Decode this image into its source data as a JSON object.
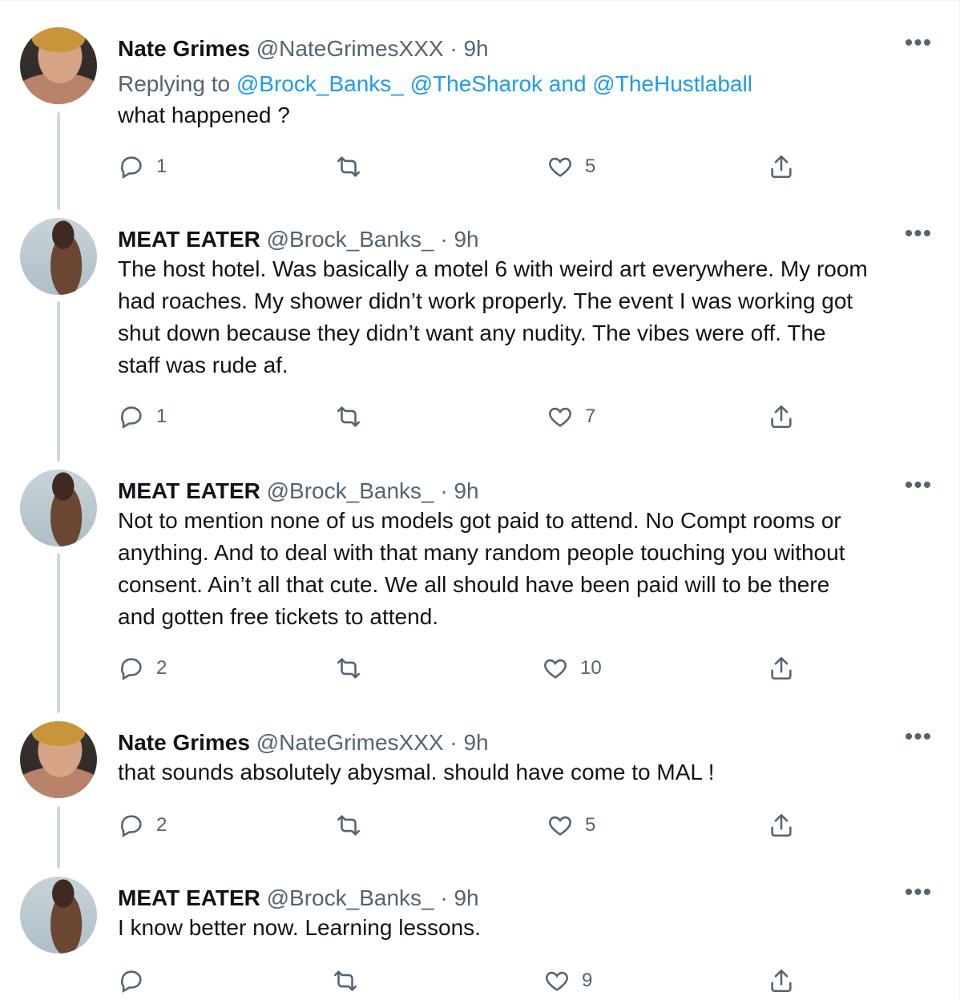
{
  "tweets": [
    {
      "name": "Nate Grimes",
      "handle": "@NateGrimesXXX",
      "separator": "·",
      "time": "9h",
      "more": "•••",
      "reply_prefix": "Replying to",
      "reply_handles": [
        "@Brock_Banks_",
        "@TheSharok",
        "@TheHustlaball"
      ],
      "reply_and": "and",
      "text": "what happened ?",
      "replies": "1",
      "retweets": "",
      "likes": "5"
    },
    {
      "name": "MEAT EATER",
      "handle": "@Brock_Banks_",
      "separator": "·",
      "time": "9h",
      "more": "•••",
      "text_lines": [
        "The host hotel. Was basically a motel 6 with weird art everywhere. My room",
        "had roaches. My shower didn’t work properly. The event I was working got",
        "shut down because they didn’t want any nudity. The vibes were off. The",
        "staff was rude af."
      ],
      "replies": "1",
      "retweets": "",
      "likes": "7"
    },
    {
      "name": "MEAT EATER",
      "handle": "@Brock_Banks_",
      "separator": "·",
      "time": "9h",
      "more": "•••",
      "text_lines": [
        "Not to mention none of us models got paid to attend. No Compt rooms or",
        "anything. And to deal with that many random people touching you without",
        "consent. Ain’t all that cute. We all should have been paid will to be there",
        "and gotten free tickets to attend."
      ],
      "replies": "2",
      "retweets": "",
      "likes": "10"
    },
    {
      "name": "Nate Grimes",
      "handle": "@NateGrimesXXX",
      "separator": "·",
      "time": "9h",
      "more": "•••",
      "text": "that sounds absolutely abysmal. should have come to MAL !",
      "replies": "2",
      "retweets": "",
      "likes": "5"
    },
    {
      "name": "MEAT EATER",
      "handle": "@Brock_Banks_",
      "separator": "·",
      "time": "9h",
      "more": "•••",
      "text": "I know better now. Learning lessons.",
      "replies": "",
      "retweets": "",
      "likes": "9"
    }
  ],
  "icons": {
    "reply": "reply-icon",
    "retweet": "retweet-icon",
    "like": "heart-icon",
    "share": "share-icon",
    "more": "more-icon"
  },
  "colors": {
    "text": "#0f1419",
    "secondary": "#536471",
    "link": "#1d9bf0",
    "thread_line": "#cfd9de"
  }
}
